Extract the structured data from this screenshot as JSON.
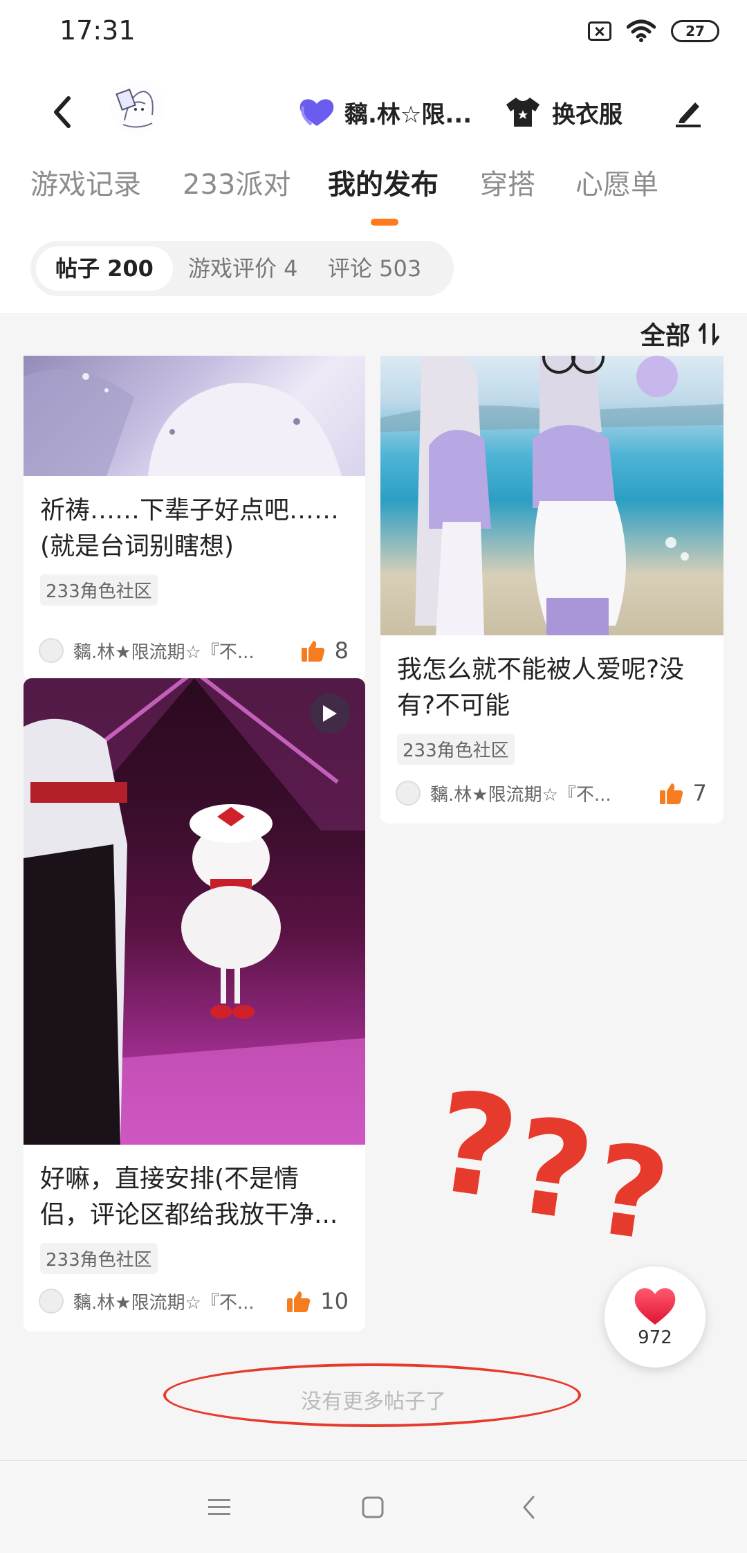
{
  "status_bar": {
    "time": "17:31",
    "battery": "27"
  },
  "header": {
    "user_name": "黐.林☆限...",
    "outfit_label": "换衣服"
  },
  "tabs": [
    {
      "label": "游戏记录"
    },
    {
      "label": "233派对"
    },
    {
      "label": "我的发布",
      "active": true
    },
    {
      "label": "穿搭"
    },
    {
      "label": "心愿单"
    }
  ],
  "subtabs": [
    {
      "label": "帖子 200",
      "active": true
    },
    {
      "label": "游戏评价 4"
    },
    {
      "label": "评论 503"
    }
  ],
  "sort": {
    "label": "全部"
  },
  "posts": [
    {
      "title": "祈祷……下辈子好点吧……(就是台词别瞎想)",
      "tag": "233角色社区",
      "author": "黐.林★限流期☆『不...",
      "likes": "8"
    },
    {
      "title": "我怎么就不能被人爱呢?没有?不可能",
      "tag": "233角色社区",
      "author": "黐.林★限流期☆『不...",
      "likes": "7"
    },
    {
      "title": "好嘛，直接安排(不是情侣，评论区都给我放干净...",
      "tag": "233角色社区",
      "author": "黐.林★限流期☆『不...",
      "likes": "10"
    }
  ],
  "footer": {
    "no_more": "没有更多帖子了"
  },
  "annotation": {
    "marks": "???"
  },
  "heart": {
    "count": "972"
  },
  "colors": {
    "accent": "#ff7a1a",
    "annotation": "#e63a2c",
    "like": "#f57c1f"
  }
}
